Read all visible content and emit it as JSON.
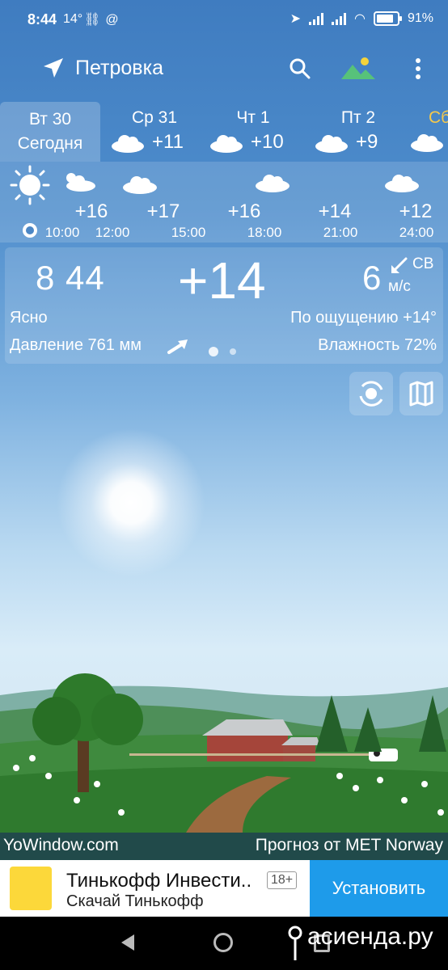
{
  "status": {
    "time": "8:44",
    "temp": "14°",
    "battery": "91%"
  },
  "header": {
    "location": "Петровка"
  },
  "days": [
    {
      "name": "Вт 30",
      "sub": "Сегодня",
      "temp": "",
      "active": true
    },
    {
      "name": "Ср 31",
      "temp": "+11",
      "icon": "cloud-icon"
    },
    {
      "name": "Чт 1",
      "temp": "+10",
      "icon": "cloud-icon"
    },
    {
      "name": "Пт 2",
      "temp": "+9",
      "icon": "cloud-icon"
    },
    {
      "name": "Сб",
      "temp": "",
      "icon": "cloud-icon"
    }
  ],
  "hourly": {
    "temps": [
      "+16",
      "+17",
      "+16",
      "+14",
      "+12"
    ],
    "times": [
      "10:00",
      "12:00",
      "15:00",
      "18:00",
      "21:00",
      "24:00"
    ]
  },
  "current": {
    "time": "8 44",
    "temp": "+14",
    "wind_speed": "6",
    "wind_dir": "СВ",
    "wind_unit": "м/с",
    "condition": "Ясно",
    "feels_like": "По ощущению +14°",
    "pressure": "Давление 761 мм",
    "humidity": "Влажность 72%"
  },
  "footer": {
    "brand": "YoWindow.com",
    "source": "Прогноз от MET Norway"
  },
  "ad": {
    "title": "Тинькофф Инвести..",
    "age": "18+",
    "subtitle": "Скачай Тинькофф",
    "button": "Установить"
  },
  "watermark": "асиенда.ру",
  "colors": {
    "sky_top": "#3f7cc0",
    "ad_button": "#1e9bea",
    "accent_yellow": "#f6c94b"
  }
}
